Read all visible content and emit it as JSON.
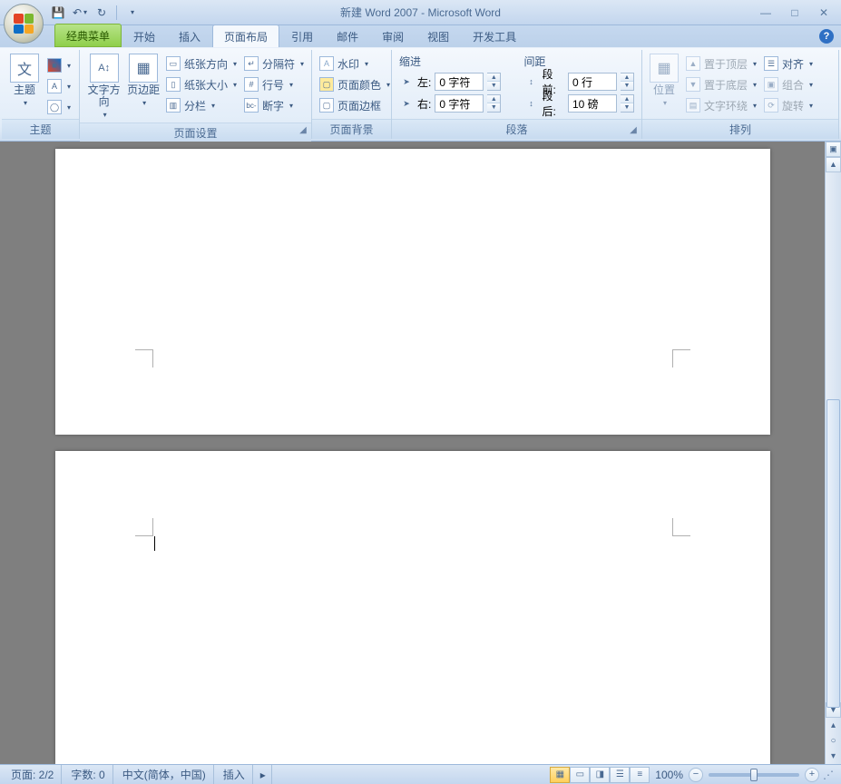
{
  "title": "新建 Word 2007 - Microsoft Word",
  "qat": {
    "save": "保存",
    "undo": "撤销",
    "redo": "重做"
  },
  "tabs": [
    "经典菜单",
    "开始",
    "插入",
    "页面布局",
    "引用",
    "邮件",
    "审阅",
    "视图",
    "开发工具"
  ],
  "active_tab_index": 3,
  "ribbon": {
    "theme": {
      "label": "主题",
      "btn": "主题"
    },
    "page_setup": {
      "label": "页面设置",
      "text_direction": "文字方向",
      "margins": "页边距",
      "orientation": "纸张方向",
      "size": "纸张大小",
      "columns": "分栏",
      "breaks": "分隔符",
      "line_numbers": "行号",
      "hyphenation": "断字"
    },
    "page_bg": {
      "label": "页面背景",
      "watermark": "水印",
      "page_color": "页面颜色",
      "page_borders": "页面边框"
    },
    "paragraph": {
      "label": "段落",
      "indent_head": "缩进",
      "spacing_head": "间距",
      "left_label": "左:",
      "right_label": "右:",
      "before_label": "段前:",
      "after_label": "段后:",
      "left_val": "0 字符",
      "right_val": "0 字符",
      "before_val": "0 行",
      "after_val": "10 磅"
    },
    "arrange": {
      "label": "排列",
      "position": "位置",
      "bring_front": "置于顶层",
      "send_back": "置于底层",
      "text_wrap": "文字环绕",
      "align": "对齐",
      "group": "组合",
      "rotate": "旋转"
    }
  },
  "status": {
    "page": "页面: 2/2",
    "words": "字数: 0",
    "lang": "中文(简体，中国)",
    "mode": "插入",
    "zoom": "100%"
  }
}
